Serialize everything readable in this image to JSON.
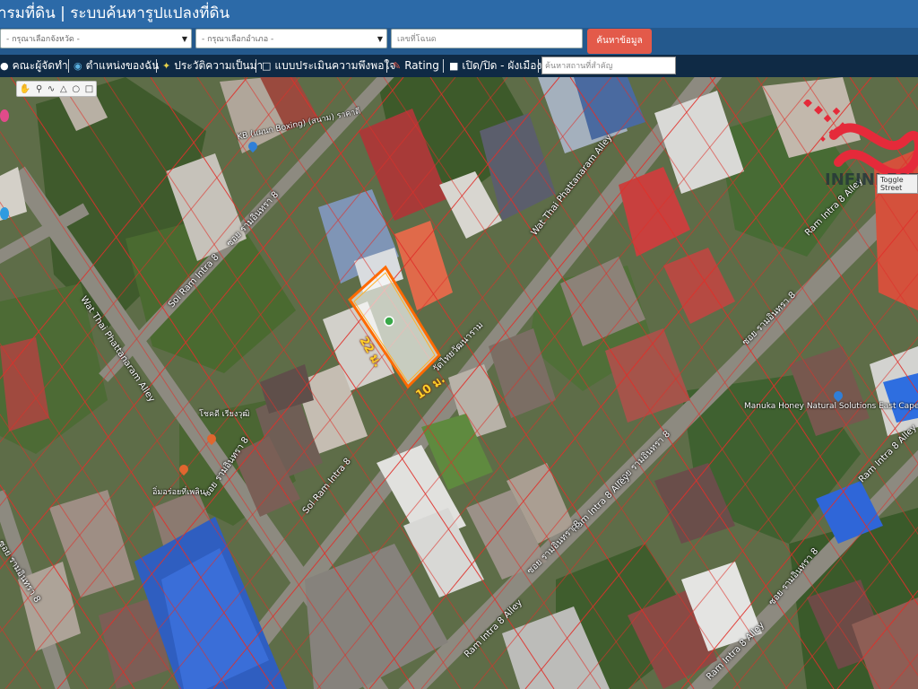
{
  "header": {
    "title": "ารมที่ดิน | ระบบค้นหารูปแปลงที่ดิน"
  },
  "search": {
    "province_placeholder": "- กรุณาเลือกจังหวัด -",
    "district_placeholder": "- กรุณาเลือกอำเภอ -",
    "deed_placeholder": "เลขที่โฉนด",
    "button_label": "ค้นหาข้อมูล"
  },
  "toolbar": {
    "items": [
      {
        "label": "คณะผู้จัดทำ",
        "icon": "people-icon"
      },
      {
        "label": "ตำแหน่งของฉัน",
        "icon": "globe-icon"
      },
      {
        "label": "ประวัติความเป็นมา",
        "icon": "history-icon"
      },
      {
        "label": "แบบประเมินความพึงพอใจ",
        "icon": "document-icon"
      },
      {
        "label": "Rating",
        "icon": "rating-icon"
      },
      {
        "label": "เปิด/ปิด - ผังเมือง",
        "icon": "square-icon"
      }
    ],
    "place_search_placeholder": "ค้นหาสถานที่สำคัญ"
  },
  "map": {
    "toggle_label": "Toggle Street",
    "plot": {
      "side_label": "22 ม.",
      "front_label": "10 ม."
    },
    "roads": [
      "Wat Thai Phattanaram Alley",
      "วัดไทยวัฒนาราม",
      "Sol Ram Intra 8",
      "ซอย รามอินทรา 8",
      "Soi Ram Intra 8",
      "ซอย รามอินทรา 8",
      "Wat Thai Phattanaram Alley",
      "ซอย รามอินทรา 8",
      "Ram Intra 8 Alley",
      "ซอย รามอินทรา 8",
      "Ram Intra 8 Alley",
      "ซอย รามอินทรา 8",
      "Ram Intra 8 Alley",
      "Ram Intra 8 Alley",
      "ซอย รามอินทรา 8",
      "Ram Intra 8 Alley",
      "ซอย รามอินทรา 8"
    ],
    "pois": [
      "KB (แผนก Boxing) (สนาม) ราคาดี",
      "Manuka Honey Natural Solutions East Cape UMF",
      "โชคดี เรียงวุฒิ",
      "อิ่มอร่อยที่เพลิน"
    ],
    "brand": "INFINI ESTATE"
  },
  "colors": {
    "header": "#2c6aa8",
    "toolbar": "#0f2a45",
    "search_button": "#e35a4a",
    "parcel_line": "#e0302a",
    "plot_outline": "#ff6a00",
    "dimension_text": "#ffd02a"
  }
}
